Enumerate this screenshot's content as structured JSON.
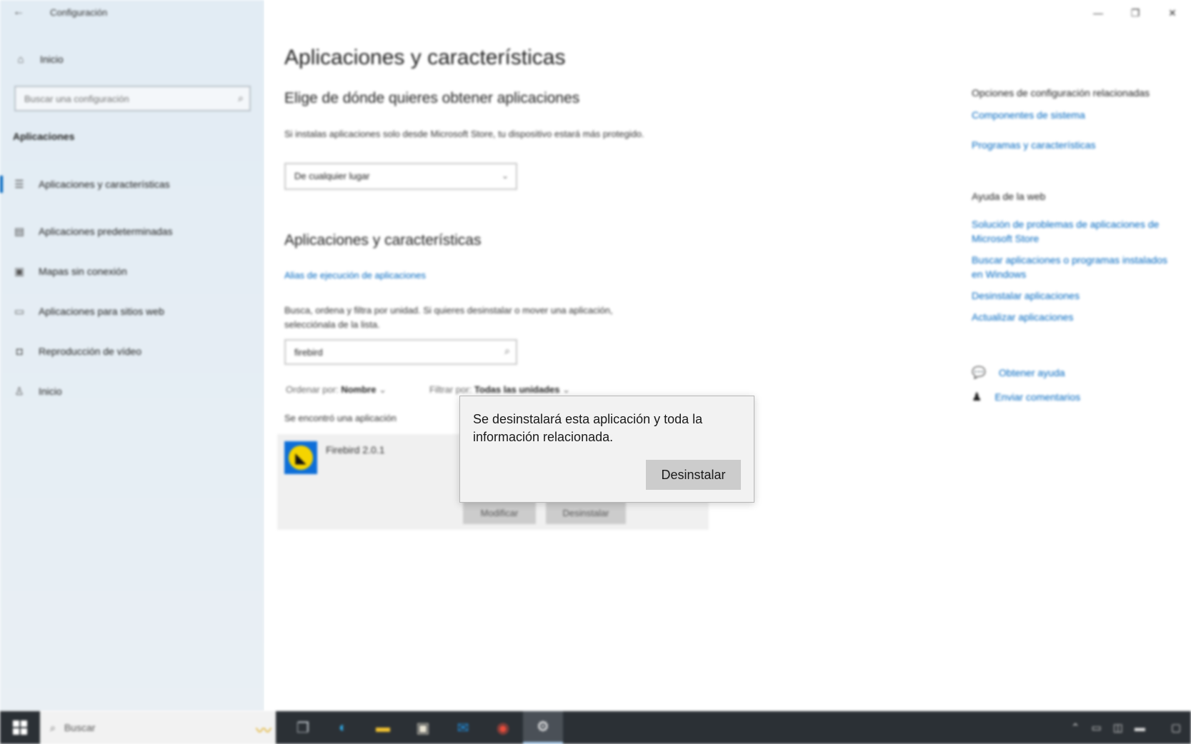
{
  "window": {
    "title": "Configuración",
    "controls": [
      "—",
      "❐",
      "✕"
    ]
  },
  "sidebar": {
    "home_label": "Inicio",
    "search_placeholder": "Buscar una configuración",
    "section": "Aplicaciones",
    "items": [
      {
        "label": "Aplicaciones y características",
        "icon": "apps-list-icon",
        "glyph": "☰"
      },
      {
        "label": "Aplicaciones predeterminadas",
        "icon": "default-apps-icon",
        "glyph": "▤"
      },
      {
        "label": "Mapas sin conexión",
        "icon": "map-icon",
        "glyph": "▣"
      },
      {
        "label": "Aplicaciones para sitios web",
        "icon": "web-apps-icon",
        "glyph": "▭"
      },
      {
        "label": "Reproducción de vídeo",
        "icon": "video-icon",
        "glyph": "◘"
      },
      {
        "label": "Inicio",
        "icon": "startup-icon",
        "glyph": "♙"
      }
    ]
  },
  "main": {
    "title": "Aplicaciones y características",
    "choose_heading": "Elige de dónde quieres obtener aplicaciones",
    "choose_desc": "Si instalas aplicaciones solo desde Microsoft Store, tu dispositivo estará más protegido.",
    "source_select": "De cualquier lugar",
    "apps_heading": "Aplicaciones y características",
    "alias_link": "Alias de ejecución de aplicaciones",
    "filter_desc": "Busca, ordena y filtra por unidad. Si quieres desinstalar o mover una aplicación, selecciónala de la lista.",
    "search_value": "firebird",
    "sort_label": "Ordenar por:",
    "sort_value": "Nombre",
    "filter_label": "Filtrar por:",
    "filter_value": "Todas las unidades",
    "found_text": "Se encontró una aplicación",
    "app": {
      "name": "Firebird 2.0.1",
      "modify_label": "Modificar",
      "uninstall_label": "Desinstalar"
    }
  },
  "related": {
    "heading": "Opciones de configuración relacionadas",
    "links": [
      "Componentes de sistema",
      "Programas y características"
    ],
    "help_heading": "Ayuda de la web",
    "help_links": [
      "Solución de problemas de aplicaciones de Microsoft Store",
      "Buscar aplicaciones o programas instalados en Windows",
      "Desinstalar aplicaciones",
      "Actualizar aplicaciones"
    ],
    "get_help": "Obtener ayuda",
    "feedback": "Enviar comentarios"
  },
  "flyout": {
    "message": "Se desinstalará esta aplicación y toda la información relacionada.",
    "button": "Desinstalar"
  },
  "taskbar": {
    "search_placeholder": "Buscar",
    "apps": [
      {
        "name": "task-view-icon",
        "glyph": "❐",
        "color": "#cfd6dc"
      },
      {
        "name": "edge-icon",
        "glyph": "◐",
        "color": "#2fa6e0"
      },
      {
        "name": "file-explorer-icon",
        "glyph": "▬",
        "color": "#f2c230"
      },
      {
        "name": "store-icon",
        "glyph": "▣",
        "color": "#e8e3d3"
      },
      {
        "name": "mail-icon",
        "glyph": "✉",
        "color": "#1e8fe0"
      },
      {
        "name": "chrome-icon",
        "glyph": "◉",
        "color": "#e74c3c"
      },
      {
        "name": "settings-icon",
        "glyph": "⚙",
        "color": "#ffffff"
      }
    ]
  },
  "colors": {
    "accent": "#0067c0",
    "taskbar": "#2b3035",
    "sidebar": "#e4edf4"
  }
}
